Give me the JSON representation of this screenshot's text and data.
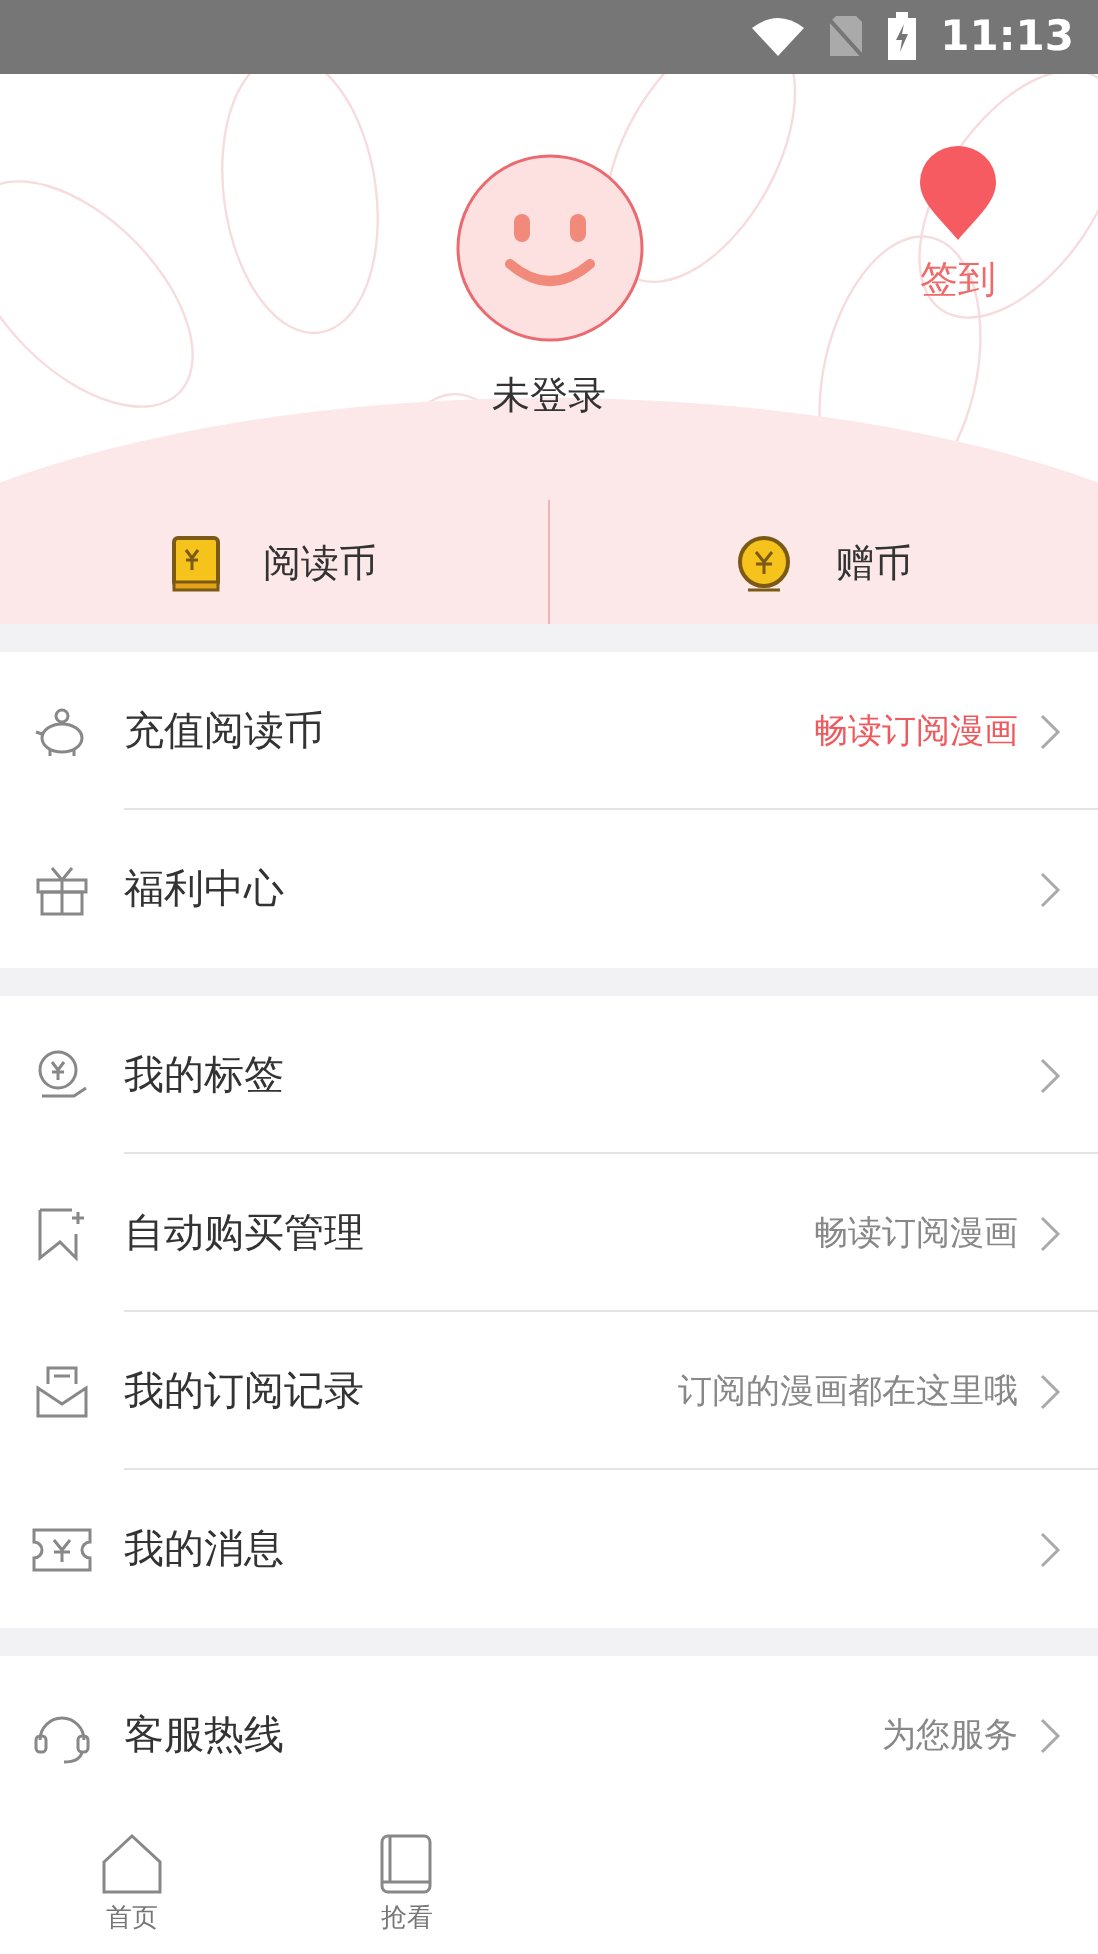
{
  "status_bar": {
    "time": "11:13"
  },
  "profile": {
    "name": "未登录",
    "checkin": "签到"
  },
  "wallet": [
    {
      "kind": "book",
      "label": "阅读币"
    },
    {
      "kind": "coin",
      "label": "赠币"
    }
  ],
  "sections": [
    {
      "items": [
        {
          "kind": "piggy",
          "label": "充值阅读币",
          "note": "畅读订阅漫画",
          "highlight": true
        },
        {
          "kind": "gift",
          "label": "福利中心"
        }
      ]
    },
    {
      "items": [
        {
          "kind": "coin-hand",
          "label": "我的标签"
        },
        {
          "kind": "bookmark",
          "label": "自动购买管理",
          "note": "畅读订阅漫画",
          "highlight": false
        },
        {
          "kind": "mail",
          "label": "我的订阅记录",
          "note": "订阅的漫画都在这里哦",
          "highlight": false
        },
        {
          "kind": "ticket",
          "label": "我的消息"
        }
      ]
    },
    {
      "items": [
        {
          "kind": "headset",
          "label": "客服热线",
          "note": "为您服务",
          "highlight": false
        }
      ]
    }
  ],
  "bottom_nav": [
    {
      "kind": "home",
      "label": "首页"
    },
    {
      "kind": "book",
      "label": "抢看"
    }
  ]
}
